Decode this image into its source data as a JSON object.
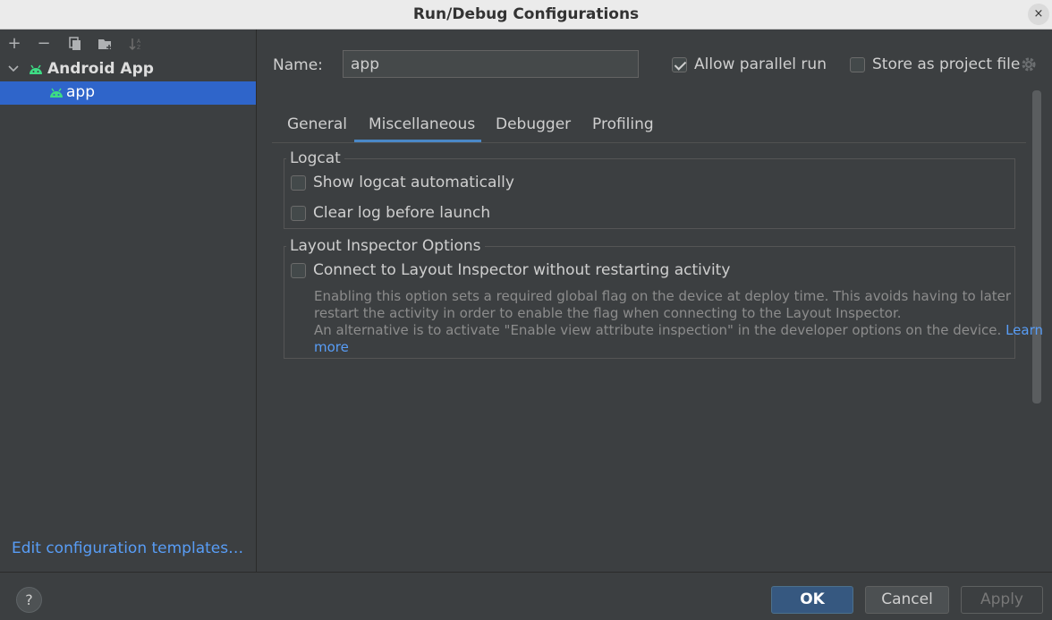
{
  "window": {
    "title": "Run/Debug Configurations",
    "close_glyph": "×"
  },
  "left_toolbar": {
    "add": "+",
    "remove": "−",
    "copy": "copy-icon",
    "folder": "new-folder-icon",
    "sort": "sort-icon"
  },
  "tree": {
    "group_label": "Android App",
    "item_label": "app"
  },
  "left_footer": {
    "edit_templates": "Edit configuration templates…"
  },
  "config": {
    "name_label": "Name:",
    "name_value": "app",
    "allow_parallel_label": "Allow parallel run",
    "allow_parallel_checked": true,
    "store_project_label": "Store as project file",
    "store_project_checked": false
  },
  "tabs": [
    "General",
    "Miscellaneous",
    "Debugger",
    "Profiling"
  ],
  "active_tab": "Miscellaneous",
  "logcat": {
    "title": "Logcat",
    "show_label": "Show logcat automatically",
    "clear_label": "Clear log before launch"
  },
  "layout_inspector": {
    "title": "Layout Inspector Options",
    "connect_label": "Connect to Layout Inspector without restarting activity",
    "desc_line1": "Enabling this option sets a required global flag on the device at deploy time. This avoids having to later",
    "desc_line2": "restart the activity in order to enable the flag when connecting to the Layout Inspector.",
    "desc_line3": "An alternative is to activate \"Enable view attribute inspection\" in the developer options on the device.",
    "link_part1": "Learn",
    "link_part2": "more"
  },
  "footer": {
    "help": "?",
    "ok": "OK",
    "cancel": "Cancel",
    "apply": "Apply"
  },
  "colors": {
    "background": "#3c3f41",
    "selection": "#2f65ca",
    "link": "#589df6",
    "android_green": "#3ddc84",
    "ok_button": "#365880"
  }
}
